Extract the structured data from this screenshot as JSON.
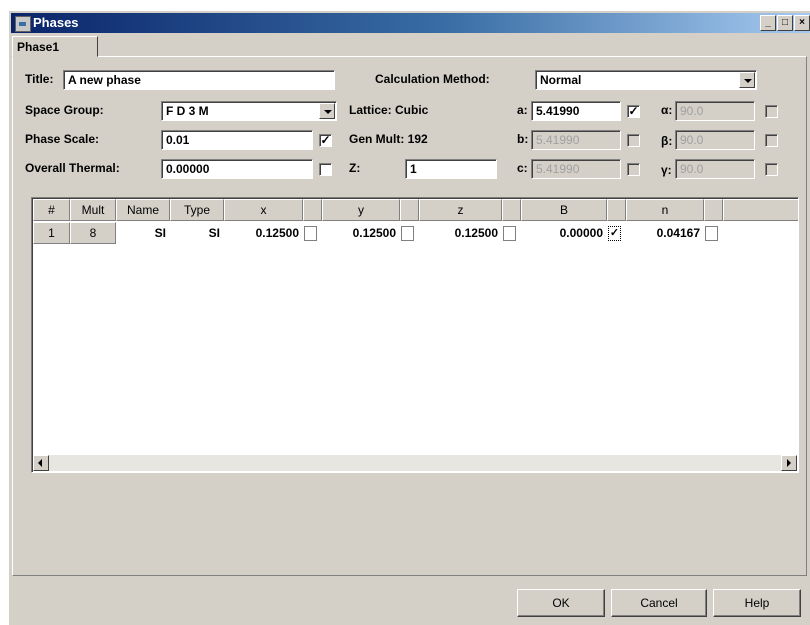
{
  "window": {
    "title": "Phases",
    "controls": [
      "_",
      "□",
      "×"
    ]
  },
  "tab": {
    "label": "Phase1"
  },
  "form": {
    "title_label": "Title:",
    "title_value": "A new phase",
    "calc_method_label": "Calculation Method:",
    "calc_method_value": "Normal",
    "space_group_label": "Space Group:",
    "space_group_value": "F D 3 M",
    "phase_scale_label": "Phase Scale:",
    "phase_scale_value": "0.01",
    "phase_scale_checked": "✓",
    "overall_thermal_label": "Overall Thermal:",
    "overall_thermal_value": "0.00000",
    "lattice_label": "Lattice: Cubic",
    "gen_mult_label": "Gen Mult: 192",
    "z_label": "Z:",
    "z_value": "1",
    "a_label": "a:",
    "a_value": "5.41990",
    "a_checked": "✓",
    "b_label": "b:",
    "b_value": "5.41990",
    "c_label": "c:",
    "c_value": "5.41990",
    "alpha_label": "α:",
    "alpha_value": "90.0",
    "beta_label": "β:",
    "beta_value": "90.0",
    "gamma_label": "γ:",
    "gamma_value": "90.0"
  },
  "table": {
    "headers": [
      "#",
      "Mult",
      "Name",
      "Type",
      "x",
      "y",
      "z",
      "B",
      "n"
    ],
    "row": {
      "num": "1",
      "mult": "8",
      "name": "SI",
      "type": "SI",
      "x": "0.12500",
      "y": "0.12500",
      "z": "0.12500",
      "B": "0.00000",
      "B_checked": "✓",
      "n": "0.04167"
    }
  },
  "buttons": {
    "ok": "OK",
    "cancel": "Cancel",
    "help": "Help"
  }
}
